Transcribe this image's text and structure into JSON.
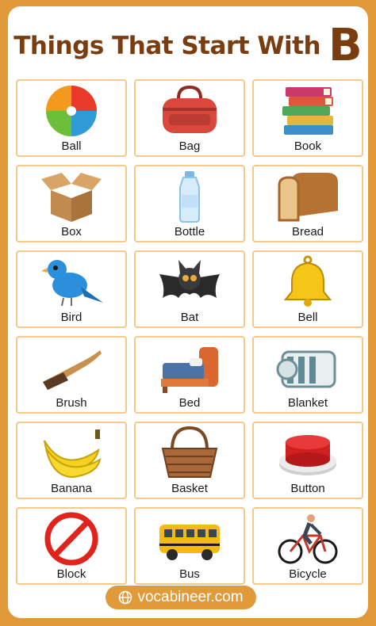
{
  "title": {
    "text": "Things That Start With",
    "letter": "B"
  },
  "items": [
    {
      "label": "Ball",
      "icon": "ball-icon"
    },
    {
      "label": "Bag",
      "icon": "bag-icon"
    },
    {
      "label": "Book",
      "icon": "book-icon"
    },
    {
      "label": "Box",
      "icon": "box-icon"
    },
    {
      "label": "Bottle",
      "icon": "bottle-icon"
    },
    {
      "label": "Bread",
      "icon": "bread-icon"
    },
    {
      "label": "Bird",
      "icon": "bird-icon"
    },
    {
      "label": "Bat",
      "icon": "bat-icon"
    },
    {
      "label": "Bell",
      "icon": "bell-icon"
    },
    {
      "label": "Brush",
      "icon": "brush-icon"
    },
    {
      "label": "Bed",
      "icon": "bed-icon"
    },
    {
      "label": "Blanket",
      "icon": "blanket-icon"
    },
    {
      "label": "Banana",
      "icon": "banana-icon"
    },
    {
      "label": "Basket",
      "icon": "basket-icon"
    },
    {
      "label": "Button",
      "icon": "button-icon"
    },
    {
      "label": "Block",
      "icon": "block-icon"
    },
    {
      "label": "Bus",
      "icon": "bus-icon"
    },
    {
      "label": "Bicycle",
      "icon": "bicycle-icon"
    }
  ],
  "footer": {
    "text": "vocabineer.com",
    "icon": "globe-icon"
  },
  "colors": {
    "frame": "#E09A3A",
    "title": "#7A3D10",
    "card_border": "#F5C98A"
  }
}
